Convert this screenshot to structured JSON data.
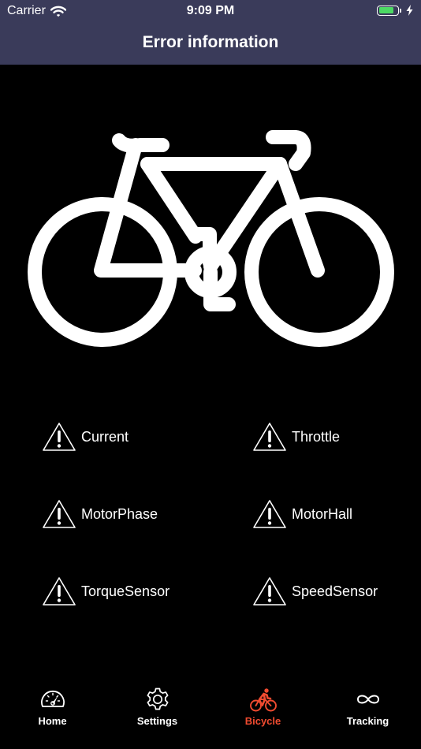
{
  "status_bar": {
    "carrier": "Carrier",
    "time": "9:09 PM",
    "battery_level": 0.8,
    "wifi_icon": "wifi-icon",
    "charging_icon": "bolt-icon"
  },
  "header": {
    "title": "Error information"
  },
  "illustration": {
    "icon": "bicycle-icon"
  },
  "errors": [
    {
      "label": "Current",
      "icon": "warning-icon"
    },
    {
      "label": "Throttle",
      "icon": "warning-icon"
    },
    {
      "label": "MotorPhase",
      "icon": "warning-icon"
    },
    {
      "label": "MotorHall",
      "icon": "warning-icon"
    },
    {
      "label": "TorqueSensor",
      "icon": "warning-icon"
    },
    {
      "label": "SpeedSensor",
      "icon": "warning-icon"
    }
  ],
  "tabs": [
    {
      "label": "Home",
      "icon": "speedometer-icon",
      "active": false
    },
    {
      "label": "Settings",
      "icon": "gear-icon",
      "active": false
    },
    {
      "label": "Bicycle",
      "icon": "cyclist-icon",
      "active": true
    },
    {
      "label": "Tracking",
      "icon": "infinity-icon",
      "active": false
    }
  ],
  "colors": {
    "header_bg": "#3a3b5a",
    "active_tab": "#f04b30",
    "battery": "#4cd964",
    "background": "#000000"
  }
}
